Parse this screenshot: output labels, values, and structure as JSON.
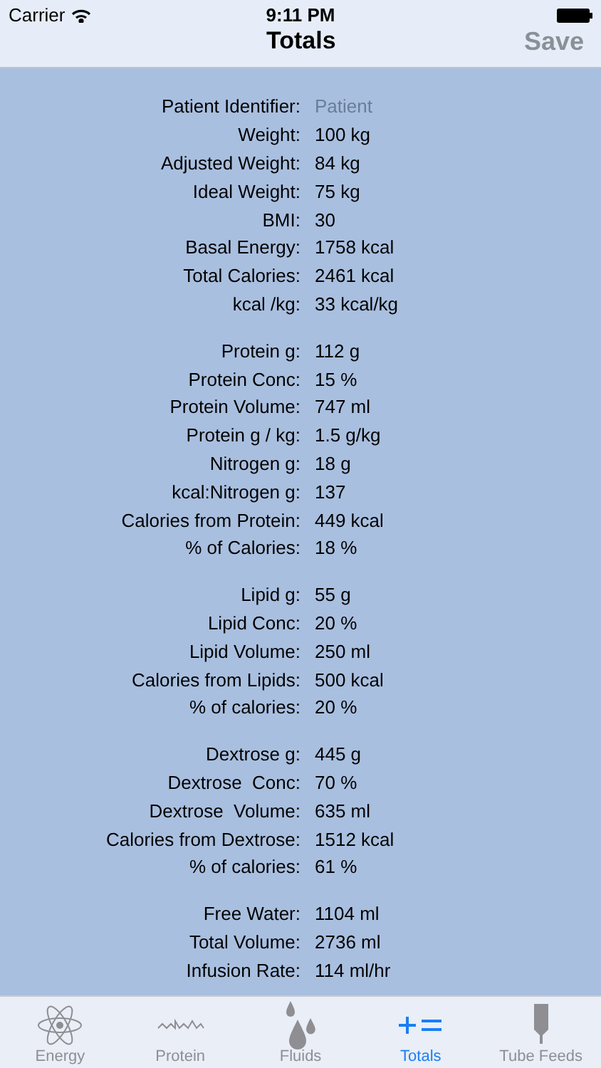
{
  "status_bar": {
    "carrier": "Carrier",
    "time": "9:11 PM"
  },
  "nav": {
    "title": "Totals",
    "save": {
      "label": "Save",
      "disabled": true
    }
  },
  "sections": [
    {
      "rows": [
        {
          "kind": "field",
          "label": "Patient Identifier:",
          "placeholder": "Patient"
        },
        {
          "kind": "text",
          "label": "Weight:",
          "value": "100 kg"
        },
        {
          "kind": "text",
          "label": "Adjusted Weight:",
          "value": "84 kg"
        },
        {
          "kind": "text",
          "label": "Ideal Weight:",
          "value": "75 kg"
        },
        {
          "kind": "text",
          "label": "BMI:",
          "value": "30"
        },
        {
          "kind": "text",
          "label": "Basal Energy:",
          "value": "1758 kcal"
        },
        {
          "kind": "text",
          "label": "Total Calories:",
          "value": "2461 kcal"
        },
        {
          "kind": "text",
          "label": "kcal /kg:",
          "value": "33 kcal/kg"
        }
      ]
    },
    {
      "rows": [
        {
          "kind": "text",
          "label": "Protein g:",
          "value": "112 g"
        },
        {
          "kind": "text",
          "label": "Protein Conc:",
          "value": "15 %"
        },
        {
          "kind": "text",
          "label": "Protein Volume:",
          "value": "747 ml"
        },
        {
          "kind": "text",
          "label": "Protein g / kg:",
          "value": "1.5 g/kg"
        },
        {
          "kind": "text",
          "label": "Nitrogen g:",
          "value": "18 g"
        },
        {
          "kind": "text",
          "label": "kcal:Nitrogen g:",
          "value": "137"
        },
        {
          "kind": "text",
          "label": "Calories from Protein:",
          "value": "449 kcal"
        },
        {
          "kind": "text",
          "label": "% of Calories:",
          "value": "18 %"
        }
      ]
    },
    {
      "rows": [
        {
          "kind": "text",
          "label": "Lipid g:",
          "value": "55 g"
        },
        {
          "kind": "text",
          "label": "Lipid Conc:",
          "value": "20 %"
        },
        {
          "kind": "text",
          "label": "Lipid Volume:",
          "value": "250 ml"
        },
        {
          "kind": "text",
          "label": "Calories from Lipids:",
          "value": "500 kcal"
        },
        {
          "kind": "text",
          "label": "% of calories:",
          "value": "20 %"
        }
      ]
    },
    {
      "rows": [
        {
          "kind": "text",
          "label": "Dextrose g:",
          "value": "445 g"
        },
        {
          "kind": "text",
          "label": "Dextrose  Conc:",
          "value": "70 %"
        },
        {
          "kind": "text",
          "label": "Dextrose  Volume:",
          "value": "635 ml"
        },
        {
          "kind": "text",
          "label": "Calories from Dextrose:",
          "value": "1512 kcal"
        },
        {
          "kind": "text",
          "label": "% of calories:",
          "value": "61 %"
        }
      ]
    },
    {
      "rows": [
        {
          "kind": "text",
          "label": "Free Water:",
          "value": "1104 ml"
        },
        {
          "kind": "text",
          "label": "Total Volume:",
          "value": "2736 ml"
        },
        {
          "kind": "text",
          "label": "Infusion Rate:",
          "value": "114 ml/hr"
        }
      ]
    }
  ],
  "tabs": [
    {
      "label": "Energy",
      "selected": false
    },
    {
      "label": "Protein",
      "selected": false
    },
    {
      "label": "Fluids",
      "selected": false
    },
    {
      "label": "Totals",
      "selected": true
    },
    {
      "label": "Tube Feeds",
      "selected": false
    }
  ]
}
